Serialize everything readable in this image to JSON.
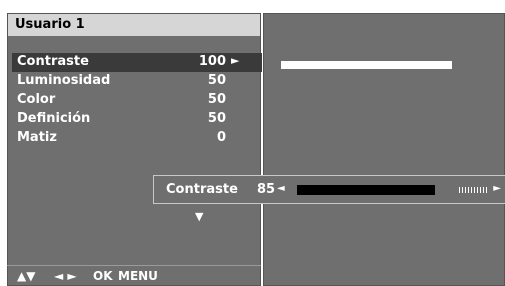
{
  "menu": {
    "title": "Usuario 1",
    "items": [
      {
        "label": "Contraste",
        "value": "100",
        "arrow": "►"
      },
      {
        "label": "Luminosidad",
        "value": "50"
      },
      {
        "label": "Color",
        "value": "50"
      },
      {
        "label": "Definición",
        "value": "50"
      },
      {
        "label": "Matiz",
        "value": "0"
      }
    ],
    "more_indicator": "▼"
  },
  "nav": {
    "updown": "▲▼",
    "leftright": "◄ ►",
    "ok": "OK",
    "menu": "MENU"
  },
  "adjust": {
    "label": "Contraste",
    "value": "85",
    "left_arrow": "◄",
    "right_arrow": "►",
    "level_fraction": 0.85
  },
  "colors": {
    "panel": "#6f6f6f",
    "title_bar": "#d6d6d6",
    "selection": "#3a3a3a"
  }
}
